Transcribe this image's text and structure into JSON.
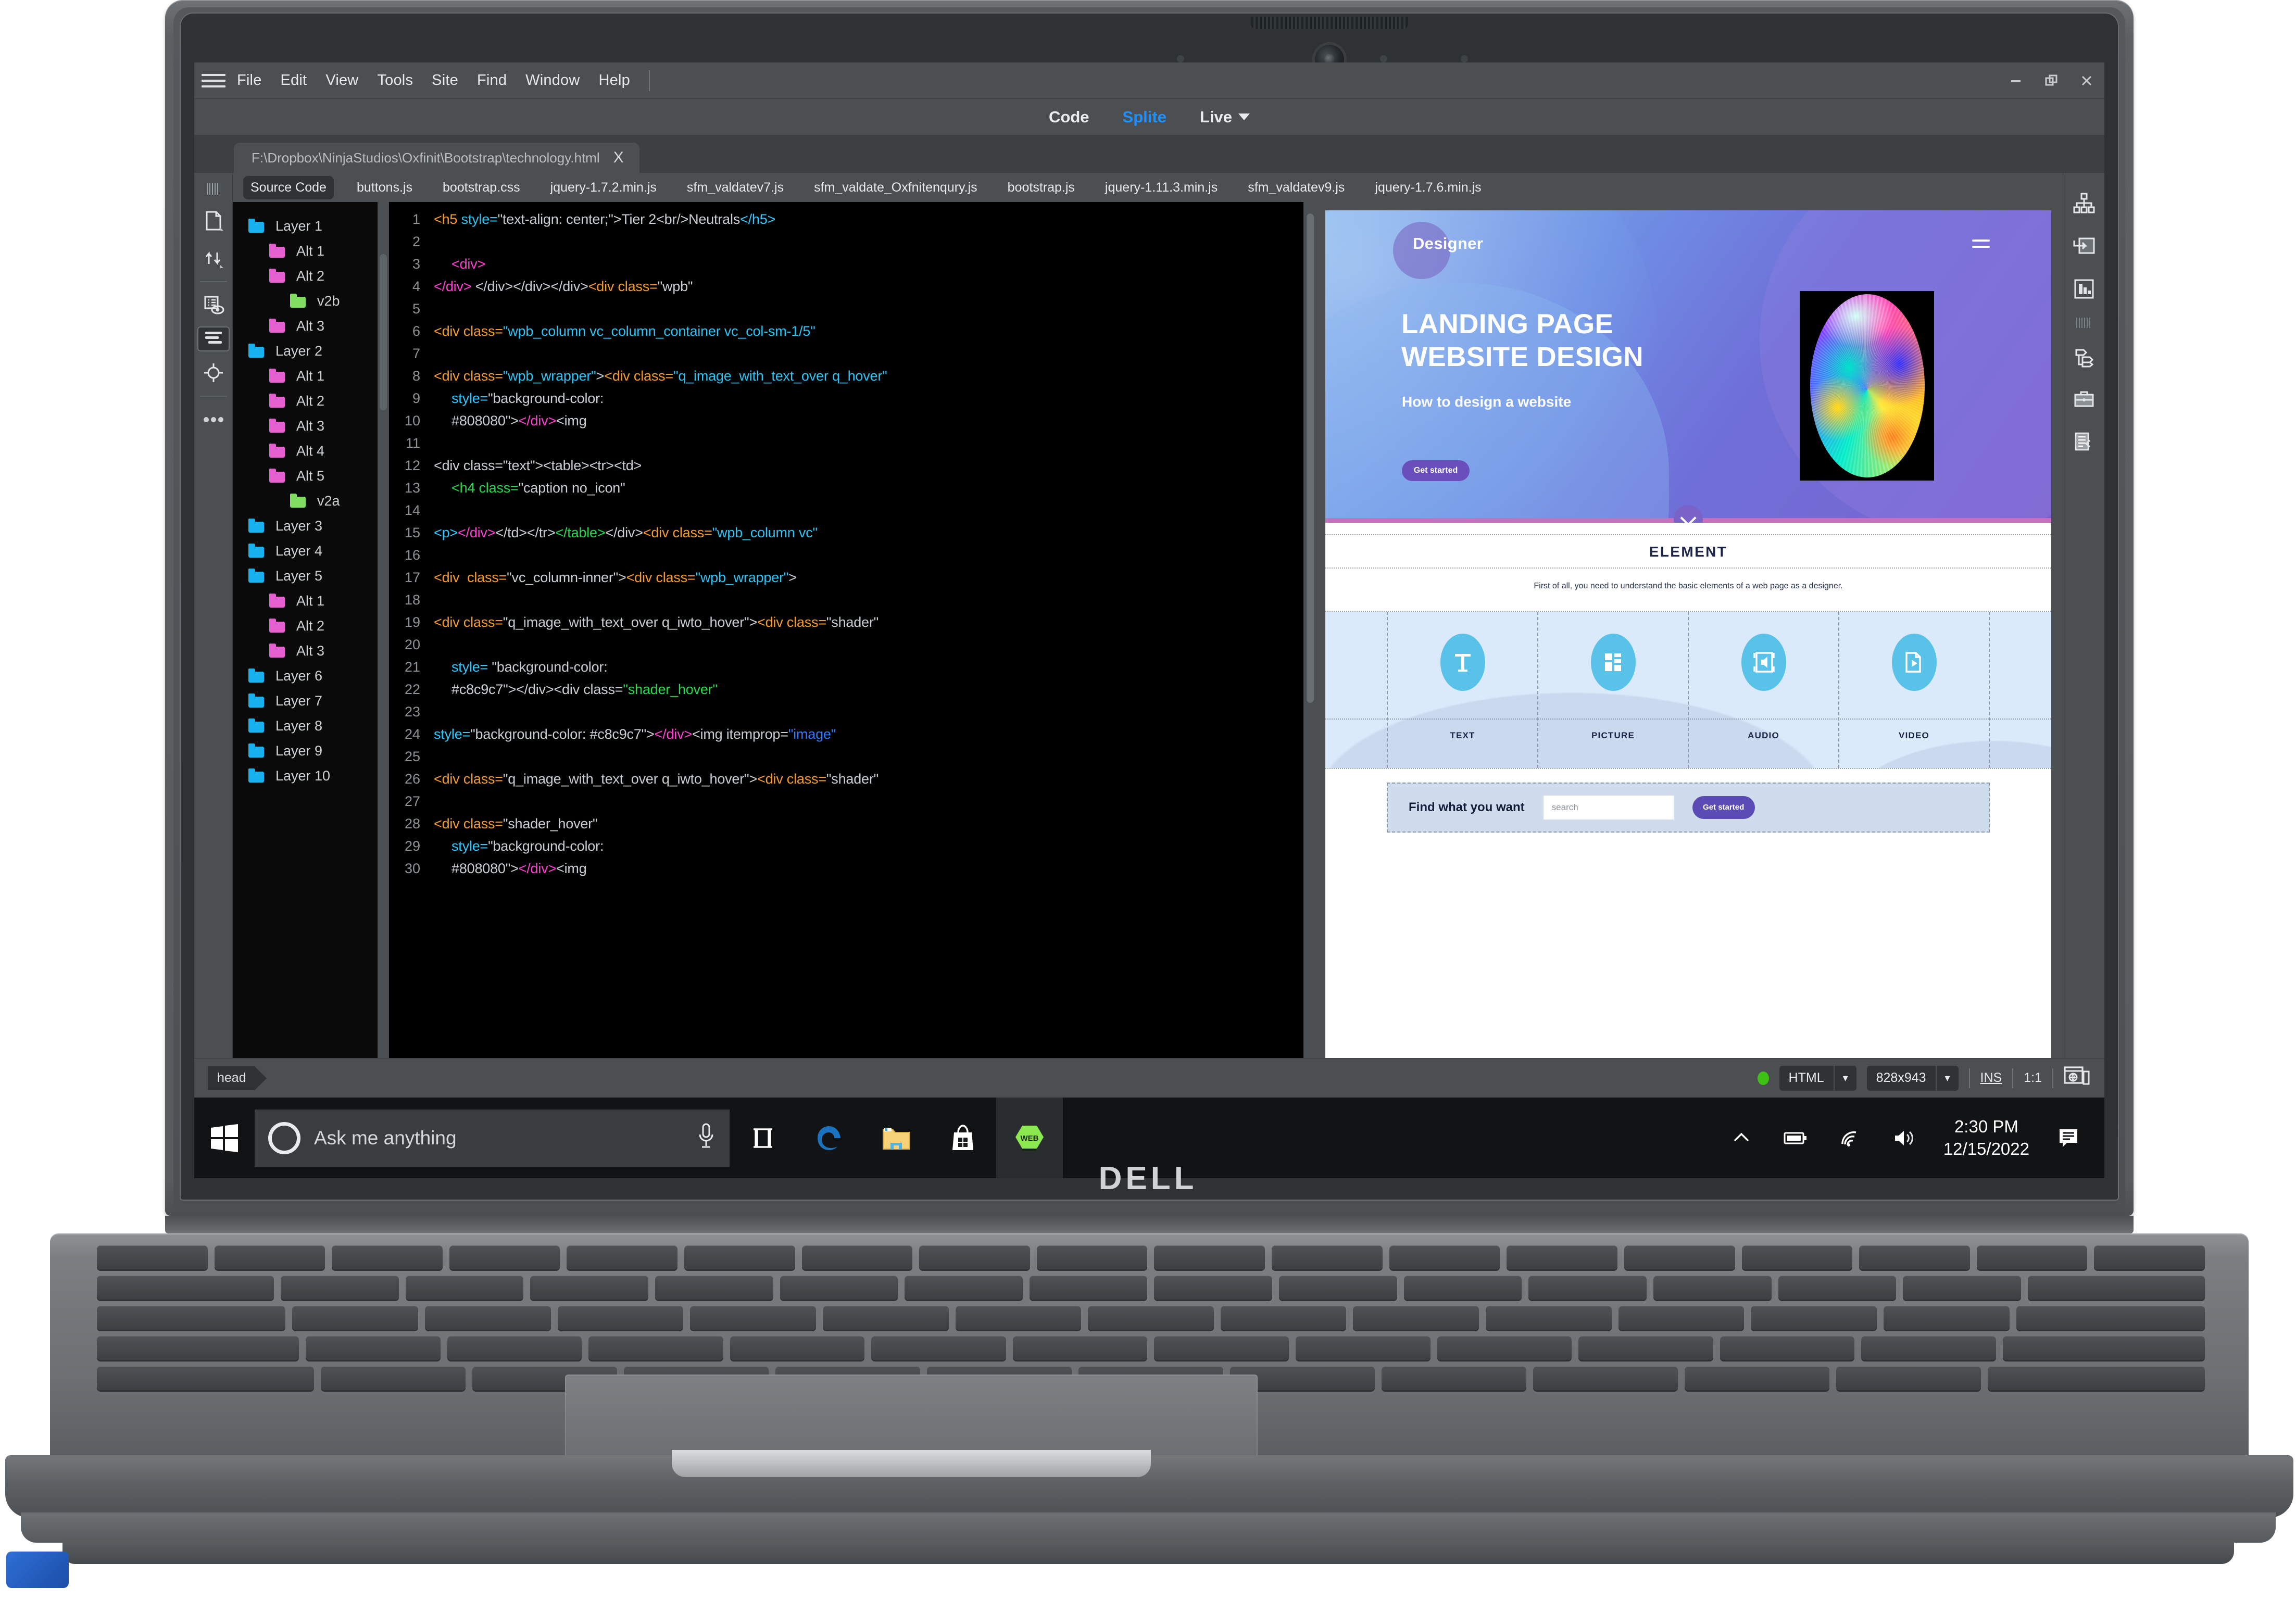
{
  "app": {
    "menu_items": [
      "File",
      "Edit",
      "View",
      "Tools",
      "Site",
      "Find",
      "Window",
      "Help"
    ],
    "window_controls": [
      "minimize",
      "restore",
      "close"
    ],
    "view_modes": [
      {
        "label": "Code",
        "active": false
      },
      {
        "label": "Splite",
        "active": true
      },
      {
        "label": "Live",
        "active": false,
        "has_caret": true
      }
    ],
    "document_tab": {
      "path": "F:\\Dropbox\\NinjaStudios\\Oxfinit\\Bootstrap\\technology.html",
      "close": "X"
    },
    "file_tabs": [
      "Source Code",
      "buttons.js",
      "bootstrap.css",
      "jquery-1.7.2.min.js",
      "sfm_valdatev7.js",
      "sfm_valdate_Oxfnitenqury.js",
      "bootstrap.js",
      "jquery-1.11.3.min.js",
      "sfm_valdatev9.js",
      "jquery-1.7.6.min.js"
    ],
    "active_file_tab": "Source Code",
    "left_rail_icons": [
      "page-properties-icon",
      "ftp-transfer-icon",
      "visual-media-query-icon",
      "format-source-code-icon",
      "live-code-target-icon",
      "more-options-icon"
    ],
    "right_rail_icons": [
      "dom-tree-icon",
      "insert-panel-icon",
      "css-designer-icon",
      "assets-panel-icon",
      "files-panel-icon",
      "snippets-icon"
    ]
  },
  "layers_panel": [
    {
      "label": "Layer 1",
      "indent": 0,
      "color": "#16b2f0"
    },
    {
      "label": "Alt 1",
      "indent": 1,
      "color": "#e55fd0"
    },
    {
      "label": "Alt 2",
      "indent": 1,
      "color": "#e55fd0"
    },
    {
      "label": "v2b",
      "indent": 2,
      "color": "#7fde60"
    },
    {
      "label": "Alt 3",
      "indent": 1,
      "color": "#e55fd0"
    },
    {
      "label": "Layer 2",
      "indent": 0,
      "color": "#16b2f0"
    },
    {
      "label": "Alt 1",
      "indent": 1,
      "color": "#e55fd0"
    },
    {
      "label": "Alt 2",
      "indent": 1,
      "color": "#e55fd0"
    },
    {
      "label": "Alt 3",
      "indent": 1,
      "color": "#e55fd0"
    },
    {
      "label": "Alt 4",
      "indent": 1,
      "color": "#e55fd0"
    },
    {
      "label": "Alt 5",
      "indent": 1,
      "color": "#e55fd0"
    },
    {
      "label": "v2a",
      "indent": 2,
      "color": "#7fde60"
    },
    {
      "label": "Layer 3",
      "indent": 0,
      "color": "#16b2f0"
    },
    {
      "label": "Layer 4",
      "indent": 0,
      "color": "#16b2f0"
    },
    {
      "label": "Layer 5",
      "indent": 0,
      "color": "#16b2f0"
    },
    {
      "label": "Alt 1",
      "indent": 1,
      "color": "#e55fd0"
    },
    {
      "label": "Alt 2",
      "indent": 1,
      "color": "#e55fd0"
    },
    {
      "label": "Alt 3",
      "indent": 1,
      "color": "#e55fd0"
    },
    {
      "label": "Layer 6",
      "indent": 0,
      "color": "#16b2f0"
    },
    {
      "label": "Layer 7",
      "indent": 0,
      "color": "#16b2f0"
    },
    {
      "label": "Layer 8",
      "indent": 0,
      "color": "#16b2f0"
    },
    {
      "label": "Layer 9",
      "indent": 0,
      "color": "#16b2f0"
    },
    {
      "label": "Layer 10",
      "indent": 0,
      "color": "#16b2f0"
    }
  ],
  "code": {
    "lines": [
      {
        "n": 1,
        "indent": 0,
        "tokens": [
          {
            "t": "<h5 ",
            "c": "tag"
          },
          {
            "t": "style=",
            "c": "attr"
          },
          {
            "t": "\"text-align: center;\">",
            "c": "plain"
          },
          {
            "t": "Tier 2<br/>Neutrals",
            "c": "plain"
          },
          {
            "t": "</h5>",
            "c": "cy"
          }
        ]
      },
      {
        "n": 2,
        "indent": 0,
        "tokens": []
      },
      {
        "n": 3,
        "indent": 1,
        "tokens": [
          {
            "t": "<div>",
            "c": "pink"
          }
        ]
      },
      {
        "n": 4,
        "indent": 0,
        "tokens": [
          {
            "t": "</div>",
            "c": "pink"
          },
          {
            "t": " </div></div></div>",
            "c": "plain"
          },
          {
            "t": "<div class=",
            "c": "tag"
          },
          {
            "t": "\"wpb\"",
            "c": "plain"
          }
        ]
      },
      {
        "n": 5,
        "indent": 0,
        "tokens": []
      },
      {
        "n": 6,
        "indent": 0,
        "tokens": [
          {
            "t": "<div class=",
            "c": "tag"
          },
          {
            "t": "\"wpb_column vc_column_container vc_col-sm-1/5\"",
            "c": "attr"
          }
        ]
      },
      {
        "n": 7,
        "indent": 0,
        "tokens": []
      },
      {
        "n": 8,
        "indent": 0,
        "tokens": [
          {
            "t": "<div class=",
            "c": "tag"
          },
          {
            "t": "\"wpb_wrapper\"",
            "c": "attr"
          },
          {
            "t": ">",
            "c": "plain"
          },
          {
            "t": "<div class=",
            "c": "tag"
          },
          {
            "t": "\"q_image_with_text_over q_hover\"",
            "c": "attr"
          }
        ]
      },
      {
        "n": 9,
        "indent": 1,
        "tokens": [
          {
            "t": "style=",
            "c": "cy"
          },
          {
            "t": "\"background-color:",
            "c": "plain"
          }
        ]
      },
      {
        "n": 10,
        "indent": 1,
        "tokens": [
          {
            "t": "#808080\">",
            "c": "plain"
          },
          {
            "t": "</div>",
            "c": "pink"
          },
          {
            "t": "<img",
            "c": "plain"
          }
        ]
      },
      {
        "n": 11,
        "indent": 0,
        "tokens": []
      },
      {
        "n": 12,
        "indent": 0,
        "tokens": [
          {
            "t": "<div class=\"text\"><table><tr><td>",
            "c": "plain"
          }
        ]
      },
      {
        "n": 13,
        "indent": 1,
        "tokens": [
          {
            "t": "<h4 class=",
            "c": "green"
          },
          {
            "t": "\"caption no_icon\"",
            "c": "plain"
          }
        ]
      },
      {
        "n": 14,
        "indent": 0,
        "tokens": []
      },
      {
        "n": 15,
        "indent": 0,
        "tokens": [
          {
            "t": "<p>",
            "c": "cy"
          },
          {
            "t": "</div>",
            "c": "pink"
          },
          {
            "t": "</td></tr>",
            "c": "plain"
          },
          {
            "t": "</table>",
            "c": "green"
          },
          {
            "t": "</div>",
            "c": "plain"
          },
          {
            "t": "<div class=",
            "c": "tag"
          },
          {
            "t": "\"wpb_column vc\"",
            "c": "attr"
          }
        ]
      },
      {
        "n": 16,
        "indent": 0,
        "tokens": []
      },
      {
        "n": 17,
        "indent": 0,
        "tokens": [
          {
            "t": "<div  class=",
            "c": "tag"
          },
          {
            "t": "\"vc_column-inner\"",
            "c": "plain"
          },
          {
            "t": ">",
            "c": "plain"
          },
          {
            "t": "<div class=",
            "c": "tag"
          },
          {
            "t": "\"wpb_wrapper\"",
            "c": "attr"
          },
          {
            "t": ">",
            "c": "plain"
          }
        ]
      },
      {
        "n": 18,
        "indent": 0,
        "tokens": []
      },
      {
        "n": 19,
        "indent": 0,
        "tokens": [
          {
            "t": "<div class=",
            "c": "tag"
          },
          {
            "t": "\"q_image_with_text_over q_iwto_hover\"",
            "c": "plain"
          },
          {
            "t": ">",
            "c": "plain"
          },
          {
            "t": "<div class=",
            "c": "tag"
          },
          {
            "t": "\"shader\"",
            "c": "plain"
          }
        ]
      },
      {
        "n": 20,
        "indent": 0,
        "tokens": []
      },
      {
        "n": 21,
        "indent": 1,
        "tokens": [
          {
            "t": "style= ",
            "c": "cy"
          },
          {
            "t": "\"background-color:",
            "c": "plain"
          }
        ]
      },
      {
        "n": 22,
        "indent": 1,
        "tokens": [
          {
            "t": "#c8c9c7\"></div><div class=",
            "c": "plain"
          },
          {
            "t": "\"shader_hover\"",
            "c": "green"
          }
        ]
      },
      {
        "n": 23,
        "indent": 0,
        "tokens": []
      },
      {
        "n": 24,
        "indent": 0,
        "tokens": [
          {
            "t": "style=",
            "c": "cy"
          },
          {
            "t": "\"background-color: #c8c9c7\">",
            "c": "plain"
          },
          {
            "t": "</div>",
            "c": "pink"
          },
          {
            "t": "<img itemprop=",
            "c": "plain"
          },
          {
            "t": "\"image\"",
            "c": "valblue"
          }
        ]
      },
      {
        "n": 25,
        "indent": 0,
        "tokens": []
      },
      {
        "n": 26,
        "indent": 0,
        "tokens": [
          {
            "t": "<div class=",
            "c": "tag"
          },
          {
            "t": "\"q_image_with_text_over q_iwto_hover\"",
            "c": "plain"
          },
          {
            "t": ">",
            "c": "plain"
          },
          {
            "t": "<div class=",
            "c": "tag"
          },
          {
            "t": "\"shader\"",
            "c": "plain"
          }
        ]
      },
      {
        "n": 27,
        "indent": 0,
        "tokens": []
      },
      {
        "n": 28,
        "indent": 0,
        "tokens": [
          {
            "t": "<div class=",
            "c": "tag"
          },
          {
            "t": "\"shader_hover\"",
            "c": "plain"
          }
        ]
      },
      {
        "n": 29,
        "indent": 1,
        "tokens": [
          {
            "t": "style=",
            "c": "cy"
          },
          {
            "t": "\"background-color:",
            "c": "plain"
          }
        ]
      },
      {
        "n": 30,
        "indent": 1,
        "tokens": [
          {
            "t": "#808080\">",
            "c": "plain"
          },
          {
            "t": "</div>",
            "c": "pink"
          },
          {
            "t": "<img",
            "c": "plain"
          }
        ]
      }
    ]
  },
  "preview": {
    "brand": "Designer",
    "hero_title_line1": "LANDING PAGE",
    "hero_title_line2": "WEBSITE DESIGN",
    "hero_subtitle": "How to design a website",
    "hero_button": "Get started",
    "element_title": "ELEMENT",
    "element_desc": "First of all, you need to understand the basic elements of a web page as a designer.",
    "tiles": [
      {
        "label": "TEXT",
        "icon": "text-icon"
      },
      {
        "label": "PICTURE",
        "icon": "picture-icon"
      },
      {
        "label": "AUDIO",
        "icon": "audio-icon"
      },
      {
        "label": "VIDEO",
        "icon": "video-icon"
      }
    ],
    "find_label": "Find what you want",
    "search_placeholder": "search",
    "find_button": "Get started",
    "accent_purple": "#6a4ebc",
    "accent_cyan": "#59c2e8"
  },
  "status_bar": {
    "tag": "head",
    "doctype": "HTML",
    "dimensions": "828x943",
    "insert_mode": "INS",
    "zoom": "1:1",
    "indicator_color": "#3fc015"
  },
  "taskbar": {
    "cortana_placeholder": "Ask me anything",
    "apps": [
      "task-view-icon",
      "edge-icon",
      "file-explorer-icon",
      "microsoft-store-icon",
      "web-app-icon"
    ],
    "tray": [
      "show-hidden-icons",
      "battery-icon",
      "wifi-icon",
      "volume-icon"
    ],
    "time": "2:30 PM",
    "date": "12/15/2022",
    "action_center": "action-center-icon"
  },
  "hardware": {
    "brand": "DELL"
  }
}
